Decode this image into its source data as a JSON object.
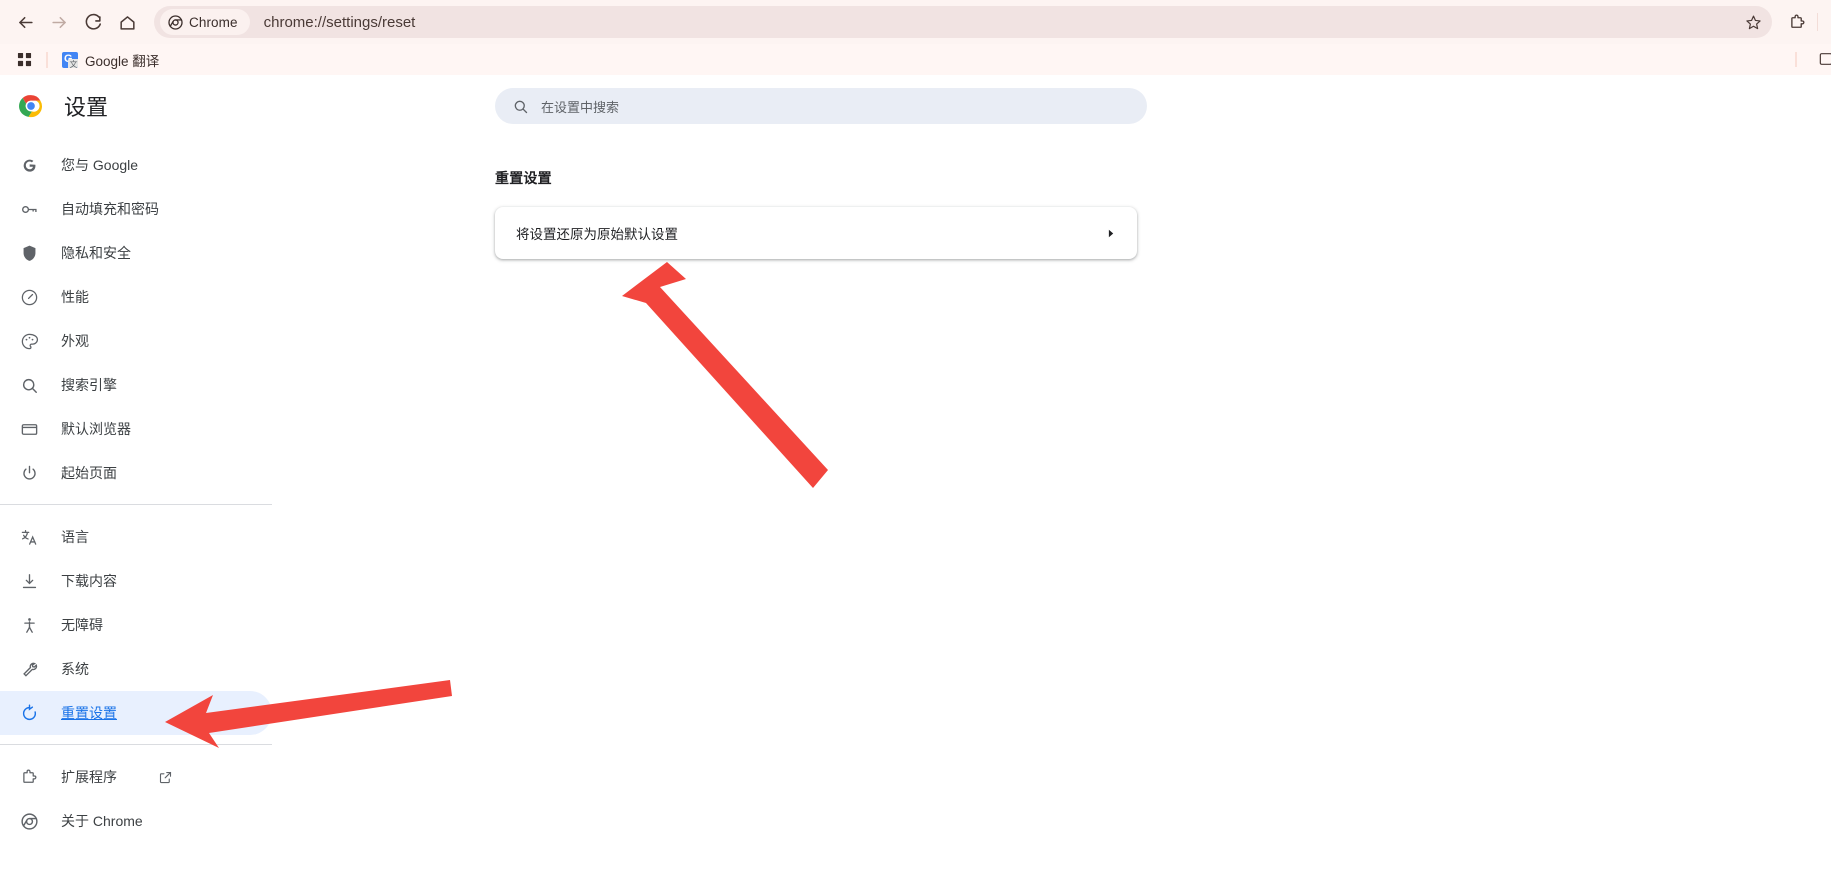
{
  "browser": {
    "nav": {
      "back_icon": "arrow-left-icon",
      "forward_icon": "arrow-right-icon",
      "reload_icon": "reload-icon",
      "home_icon": "home-icon"
    },
    "omnibox": {
      "chip_label": "Chrome",
      "chip_icon": "chrome-logo-icon",
      "url": "chrome://settings/reset",
      "bookmark_icon": "star-icon"
    },
    "extensions_icon": "puzzle-piece-icon",
    "bookmarks_bar": {
      "apps_icon": "apps-grid-icon",
      "items": [
        {
          "label": "Google 翻译",
          "favicon": "google-translate-favicon"
        }
      ],
      "overflow_icon": "reading-list-icon"
    },
    "colors": {
      "toolbar_bg": "#fdf4f2",
      "omnibox_bg": "#f1e3e2",
      "bookmarks_bg": "#fff6f4"
    }
  },
  "settings": {
    "brand": {
      "logo_icon": "chrome-color-logo-icon",
      "title": "设置"
    },
    "sidebar": {
      "groups": [
        {
          "items": [
            {
              "label": "您与 Google",
              "icon": "google-g-icon",
              "selected": false
            },
            {
              "label": "自动填充和密码",
              "icon": "key-icon",
              "selected": false
            },
            {
              "label": "隐私和安全",
              "icon": "shield-icon",
              "selected": false
            },
            {
              "label": "性能",
              "icon": "speedometer-icon",
              "selected": false
            },
            {
              "label": "外观",
              "icon": "palette-icon",
              "selected": false
            },
            {
              "label": "搜索引擎",
              "icon": "search-icon",
              "selected": false
            },
            {
              "label": "默认浏览器",
              "icon": "browser-window-icon",
              "selected": false
            },
            {
              "label": "起始页面",
              "icon": "power-icon",
              "selected": false
            }
          ]
        },
        {
          "items": [
            {
              "label": "语言",
              "icon": "translate-icon",
              "selected": false
            },
            {
              "label": "下载内容",
              "icon": "download-icon",
              "selected": false
            },
            {
              "label": "无障碍",
              "icon": "accessibility-icon",
              "selected": false
            },
            {
              "label": "系统",
              "icon": "wrench-icon",
              "selected": false
            },
            {
              "label": "重置设置",
              "icon": "reset-circular-arrow-icon",
              "selected": true
            }
          ]
        },
        {
          "items": [
            {
              "label": "扩展程序",
              "icon": "puzzle-piece-icon",
              "external_icon": "open-in-new-icon",
              "selected": false
            },
            {
              "label": "关于 Chrome",
              "icon": "chrome-outline-icon",
              "selected": false
            }
          ]
        }
      ],
      "selected_colors": {
        "pill_bg": "#e8f0fe",
        "text": "#1a73e8"
      }
    },
    "search": {
      "placeholder": "在设置中搜索",
      "icon": "search-icon",
      "value": ""
    },
    "section": {
      "title": "重置设置",
      "rows": [
        {
          "label": "将设置还原为原始默认设置",
          "arrow_icon": "chevron-right-icon"
        }
      ]
    }
  },
  "annotations": {
    "color": "#f2453d",
    "arrows": [
      {
        "name": "arrow-to-reset-row",
        "points_to": "将设置还原为原始默认设置"
      },
      {
        "name": "arrow-to-reset-settings-nav",
        "points_to": "重置设置"
      }
    ]
  }
}
